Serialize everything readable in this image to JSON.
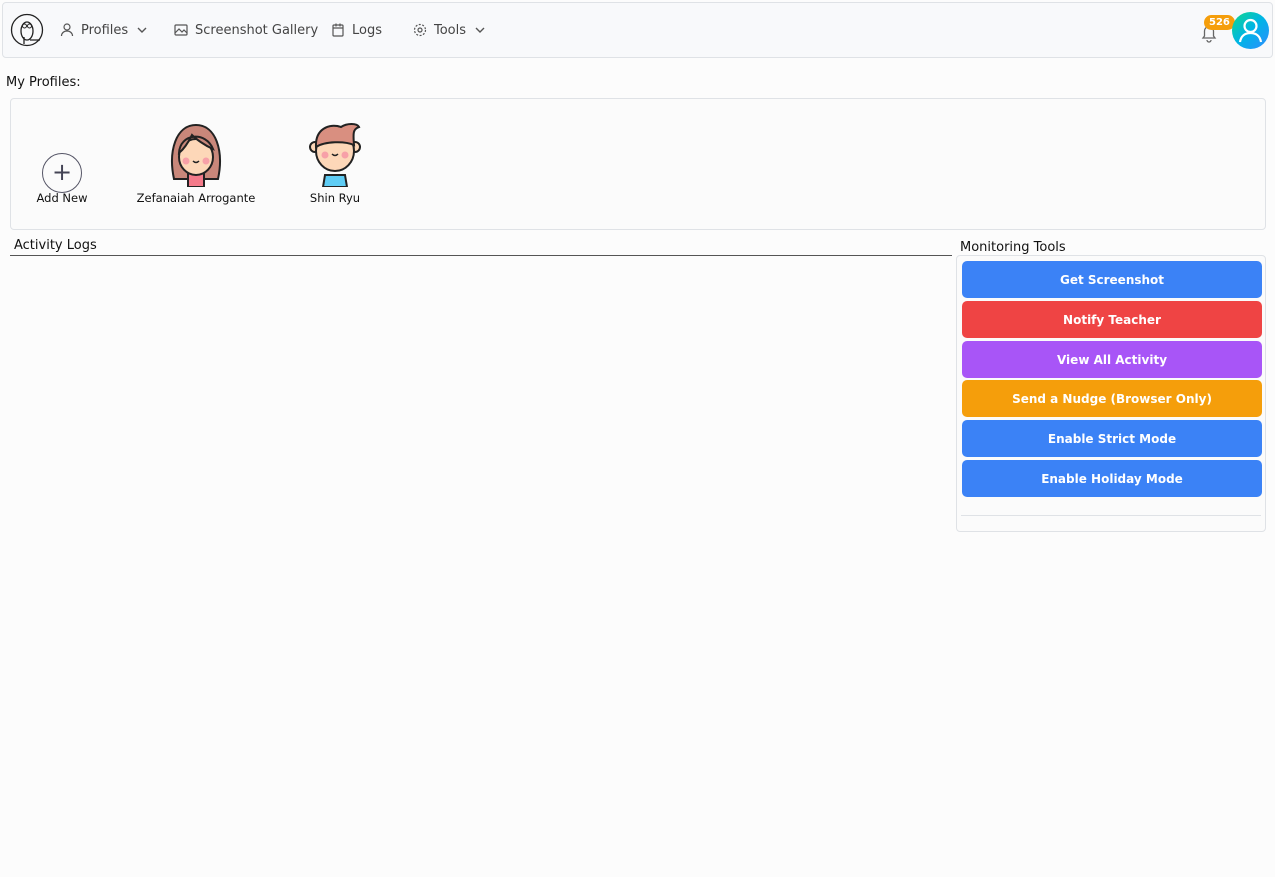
{
  "nav": {
    "items": [
      {
        "label": "Profiles",
        "icon": "user-icon"
      },
      {
        "label": "Screenshot Gallery",
        "icon": "image-icon"
      },
      {
        "label": "Logs",
        "icon": "calendar-icon"
      },
      {
        "label": "Tools",
        "icon": "gear-icon"
      }
    ],
    "notification_count": "526"
  },
  "profiles": {
    "title": "My Profiles:",
    "add_label": "Add New",
    "items": [
      {
        "name": "Zefanaiah Arrogante"
      },
      {
        "name": "Shin Ryu"
      }
    ]
  },
  "activity": {
    "title": "Activity Logs"
  },
  "tools": {
    "title": "Monitoring Tools",
    "buttons": [
      {
        "label": "Get Screenshot",
        "color": "#3b82f6"
      },
      {
        "label": "Notify Teacher",
        "color": "#ef4444"
      },
      {
        "label": "View All Activity",
        "color": "#a855f7"
      },
      {
        "label": "Send a Nudge (Browser Only)",
        "color": "#f59e0b"
      },
      {
        "label": "Enable Strict Mode",
        "color": "#3b82f6"
      },
      {
        "label": "Enable Holiday Mode",
        "color": "#3b82f6"
      }
    ]
  }
}
